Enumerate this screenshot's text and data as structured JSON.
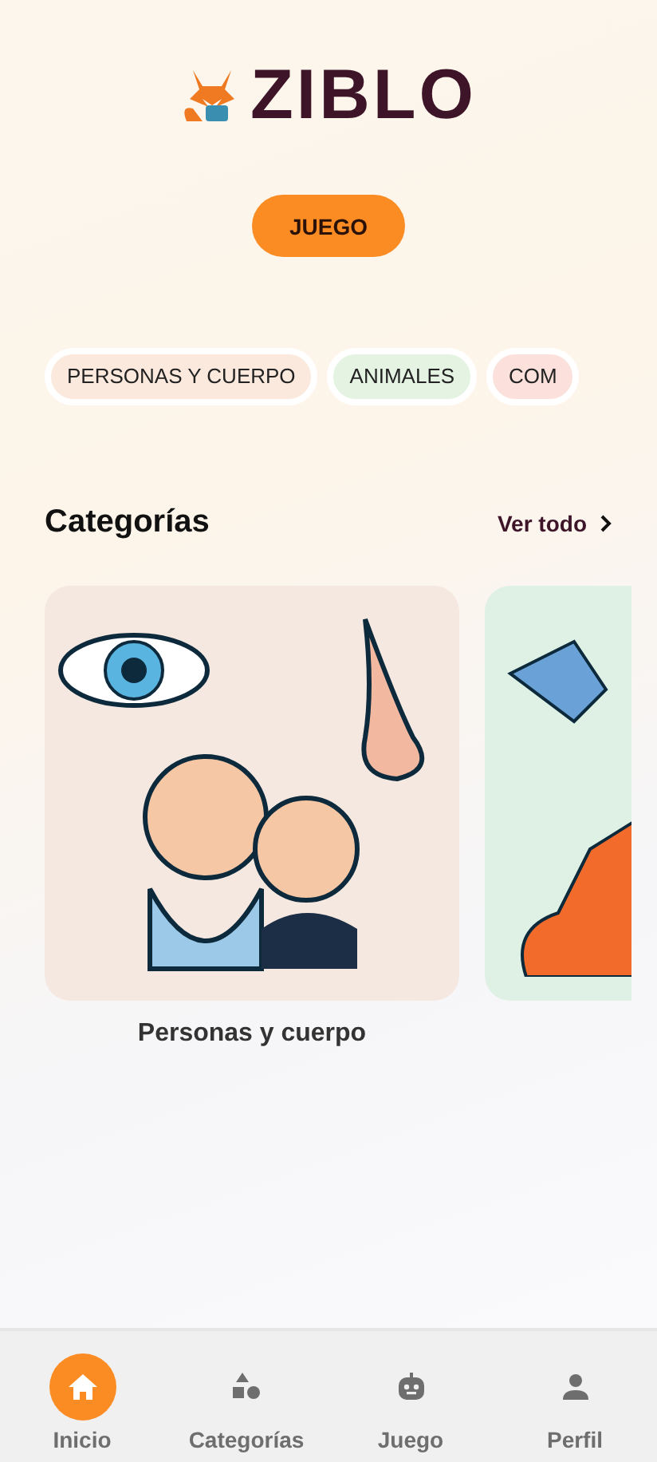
{
  "logo": {
    "text": "ZIBLO"
  },
  "play_button": {
    "label": "JUEGO"
  },
  "chips": [
    {
      "label": "PERSONAS Y CUERPO",
      "color": "#fbe9dd"
    },
    {
      "label": "ANIMALES",
      "color": "#e4f3e2"
    },
    {
      "label": "COM",
      "color": "#fbe0dc"
    }
  ],
  "section": {
    "title": "Categorías",
    "link": "Ver todo"
  },
  "cards": [
    {
      "kind": "people",
      "label": "Personas y cuerpo",
      "color": "#f5e8e0"
    },
    {
      "kind": "animals",
      "color": "#def1e4"
    }
  ],
  "nav": [
    {
      "kind": "home",
      "label": "Inicio",
      "selected": true
    },
    {
      "kind": "shapes",
      "label": "Categorías",
      "selected": false
    },
    {
      "kind": "robot",
      "label": "Juego",
      "selected": false
    },
    {
      "kind": "person",
      "label": "Perfil",
      "selected": false
    }
  ]
}
